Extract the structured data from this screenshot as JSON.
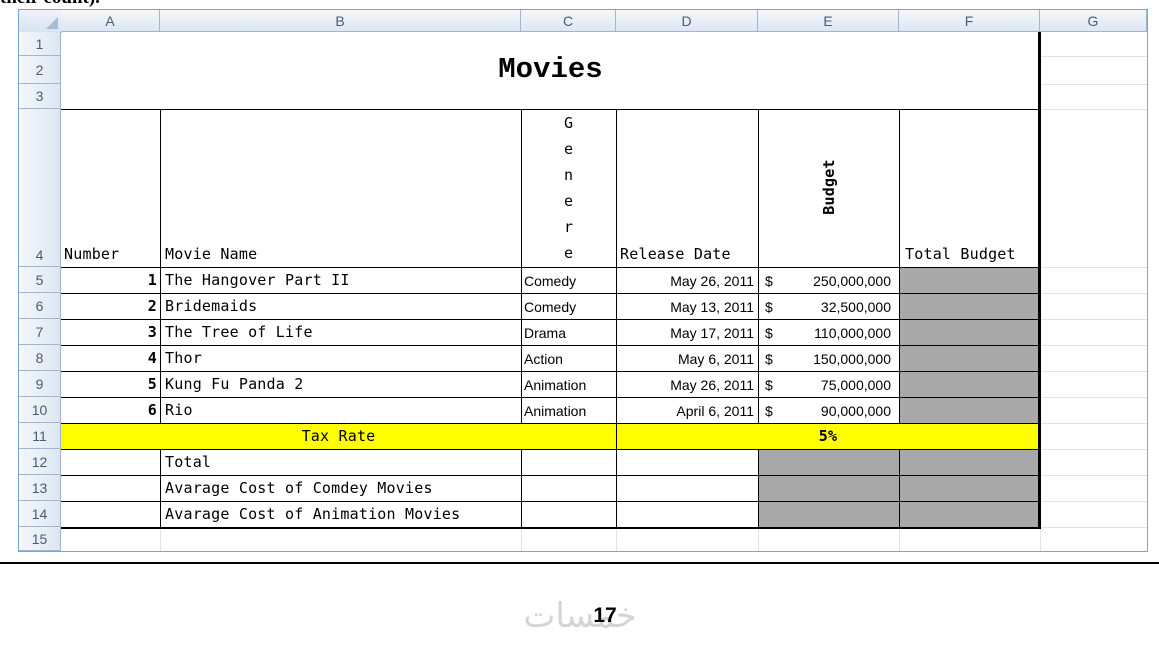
{
  "cut_text": "their count).",
  "spreadsheet": {
    "columns": [
      "A",
      "B",
      "C",
      "D",
      "E",
      "F",
      "G"
    ],
    "rows": [
      "1",
      "2",
      "3",
      "4",
      "5",
      "6",
      "7",
      "8",
      "9",
      "10",
      "11",
      "12",
      "13",
      "14",
      "15"
    ],
    "title": "Movies",
    "headers": {
      "number": "Number",
      "movie_name": "Movie Name",
      "genre_letters": [
        "G",
        "e",
        "n",
        "e",
        "r",
        "e"
      ],
      "release_date": "Release Date",
      "budget": "Budget",
      "total_budget": "Total Budget"
    },
    "movies": [
      {
        "number": "1",
        "name": "The Hangover Part II",
        "genre": "Comedy",
        "date": "May 26, 2011",
        "currency": "$",
        "budget": "250,000,000"
      },
      {
        "number": "2",
        "name": "Bridemaids",
        "genre": "Comedy",
        "date": "May 13, 2011",
        "currency": "$",
        "budget": "32,500,000"
      },
      {
        "number": "3",
        "name": "The Tree of Life",
        "genre": "Drama",
        "date": "May 17, 2011",
        "currency": "$",
        "budget": "110,000,000"
      },
      {
        "number": "4",
        "name": "Thor",
        "genre": "Action",
        "date": "May 6, 2011",
        "currency": "$",
        "budget": "150,000,000"
      },
      {
        "number": "5",
        "name": "Kung Fu Panda 2",
        "genre": "Animation",
        "date": "May 26, 2011",
        "currency": "$",
        "budget": "75,000,000"
      },
      {
        "number": "6",
        "name": "Rio",
        "genre": "Animation",
        "date": "April 6, 2011",
        "currency": "$",
        "budget": "90,000,000"
      }
    ],
    "tax_rate_label": "Tax Rate",
    "tax_rate_value": "5%",
    "summary_labels": [
      "Total",
      "Avarage Cost of Comdey Movies",
      "Avarage Cost of Animation Movies"
    ],
    "colors": {
      "highlight": "#ffff00",
      "shaded": "#a8a8a8",
      "header_bg": "#dce6f2"
    }
  },
  "page_number": "17",
  "watermark": "خمسات"
}
